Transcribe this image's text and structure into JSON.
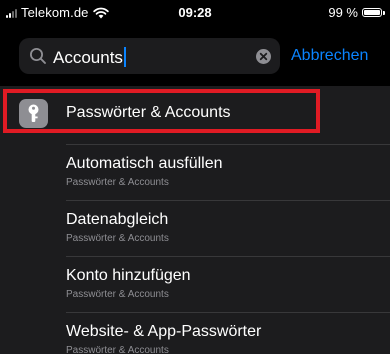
{
  "status_bar": {
    "carrier": "Telekom.de",
    "time": "09:28",
    "battery_percent": "99 %",
    "battery_level": 0.99
  },
  "search": {
    "query": "Accounts",
    "cancel_label": "Abbrechen"
  },
  "top_result": {
    "title": "Passwörter & Accounts",
    "icon": "key-icon"
  },
  "results": [
    {
      "title": "Automatisch ausfüllen",
      "subtitle": "Passwörter & Accounts"
    },
    {
      "title": "Datenabgleich",
      "subtitle": "Passwörter & Accounts"
    },
    {
      "title": "Konto hinzufügen",
      "subtitle": "Passwörter & Accounts"
    },
    {
      "title": "Website- & App-Passwörter",
      "subtitle": "Passwörter & Accounts"
    }
  ],
  "colors": {
    "accent": "#0a84ff",
    "highlight": "#e01b24",
    "background": "#000000",
    "cell": "#1c1c1e"
  }
}
